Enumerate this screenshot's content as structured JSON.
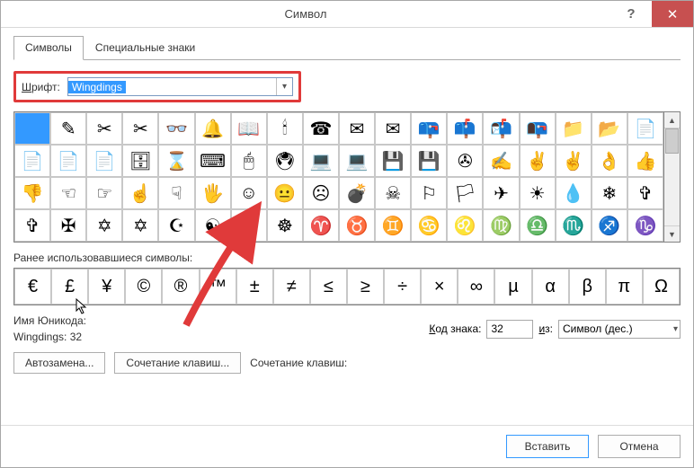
{
  "window": {
    "title": "Символ"
  },
  "tabs": {
    "symbols": "Символы",
    "special": "Специальные знаки"
  },
  "font": {
    "label_prefix": "Ш",
    "label_rest": "рифт:",
    "value": "Wingdings"
  },
  "grid_rows": [
    [
      " ",
      "✎",
      "✂",
      "✂",
      "👓",
      "🔔",
      "📖",
      "🕯",
      "☎",
      "✉",
      "✉",
      "📪",
      "📫",
      "📬",
      "📭",
      "📁",
      "📂",
      "📄",
      " ",
      " "
    ],
    [
      "📄",
      "📄",
      "📄",
      "🗄",
      "⌛",
      "⌨",
      "🖱",
      "🖲",
      "💻",
      "💻",
      "💾",
      "💾",
      "✇",
      "✍",
      "✌",
      "✌",
      "👌",
      "👍",
      "",
      ""
    ],
    [
      "👎",
      "☜",
      "☞",
      "☝",
      "☟",
      "🖐",
      "☺",
      "😐",
      "☹",
      "💣",
      "☠",
      "⚐",
      "🏳",
      "✈",
      "☀",
      "💧",
      "❄",
      "✞",
      "",
      ""
    ],
    [
      "✞",
      "✠",
      "✡",
      "✡",
      "☪",
      "☯",
      "ॐ",
      "☸",
      "♈",
      "♉",
      "♊",
      "♋",
      "♌",
      "♍",
      "♎",
      "♏",
      "♐",
      "♑",
      "",
      ""
    ]
  ],
  "recent": {
    "label": "Ранее использовавшиеся символы:",
    "chars": [
      "€",
      "£",
      "¥",
      "©",
      "®",
      "™",
      "±",
      "≠",
      "≤",
      "≥",
      "÷",
      "×",
      "∞",
      "µ",
      "α",
      "β",
      "π",
      "Ω"
    ]
  },
  "unicode": {
    "name_label": "Имя Юникода:",
    "value": "Wingdings: 32",
    "code_label_u": "К",
    "code_label_rest": "од знака:",
    "code_value": "32",
    "from_label_u": "и",
    "from_label_rest": "з:",
    "from_value": "Символ (дес.)"
  },
  "buttons": {
    "autocorrect": "Автозамена...",
    "shortcut": "Сочетание клавиш...",
    "shortcut_label": "Сочетание клавиш:",
    "insert": "Вставить",
    "cancel": "Отмена"
  }
}
